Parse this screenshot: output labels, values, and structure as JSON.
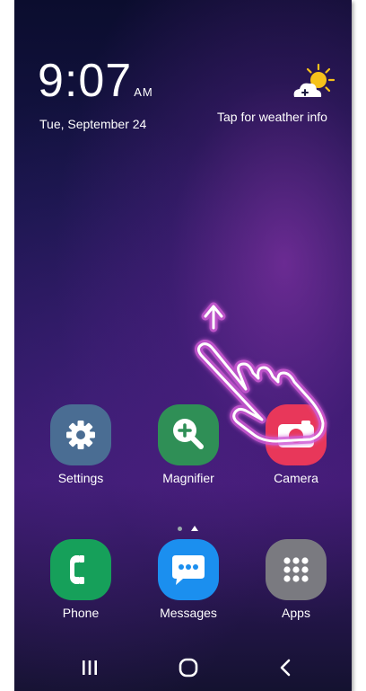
{
  "clock": {
    "time": "9:07",
    "ampm": "AM",
    "date": "Tue, September 24"
  },
  "weather": {
    "label": "Tap for weather info",
    "icon": "weather-sun-cloud-icon"
  },
  "apps": [
    {
      "label": "Settings",
      "icon": "gear-icon",
      "color": "#4a6d93"
    },
    {
      "label": "Magnifier",
      "icon": "magnifier-icon",
      "color": "#2f8f56"
    },
    {
      "label": "Camera",
      "icon": "camera-icon",
      "color": "#e8375a"
    }
  ],
  "dock": [
    {
      "label": "Phone",
      "icon": "phone-icon",
      "color": "#16a05a"
    },
    {
      "label": "Messages",
      "icon": "messages-icon",
      "color": "#1b8fef"
    },
    {
      "label": "Apps",
      "icon": "apps-grid-icon",
      "color": "#7a7a80"
    }
  ],
  "page_indicator": {
    "pages": 2,
    "current": 2
  },
  "navbar": {
    "recents_icon": "recents-icon",
    "home_icon": "home-icon",
    "back_icon": "back-icon"
  },
  "overlay": {
    "gesture": "swipe-up-hand-icon"
  }
}
